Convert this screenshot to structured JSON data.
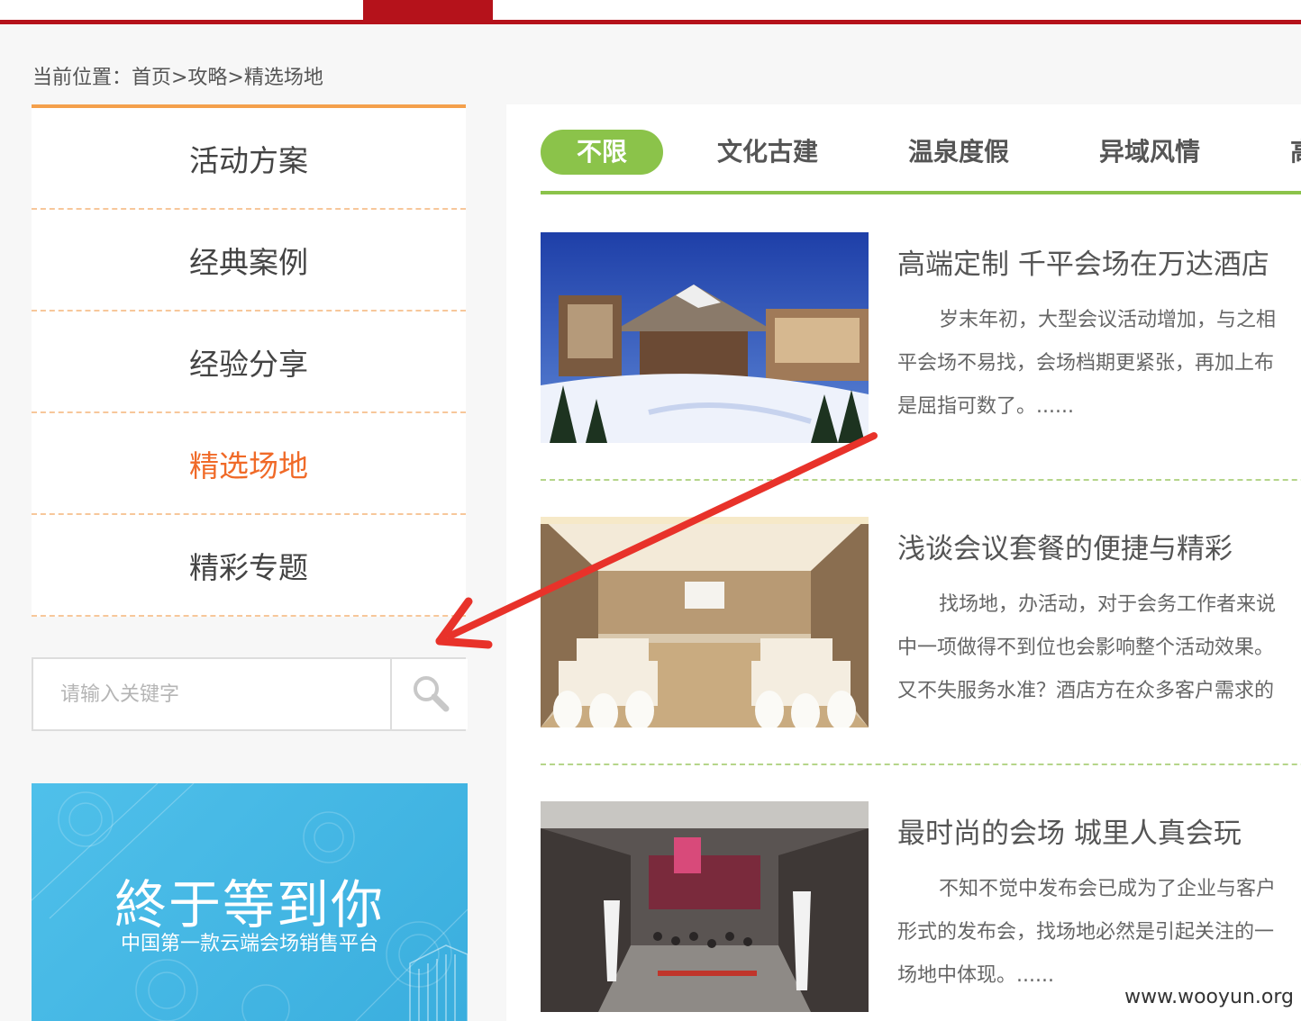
{
  "breadcrumb": {
    "text": "当前位置：首页>攻略>精选场地"
  },
  "sidebar": {
    "items": [
      {
        "label": "活动方案"
      },
      {
        "label": "经典案例"
      },
      {
        "label": "经验分享"
      },
      {
        "label": "精选场地",
        "active": true
      },
      {
        "label": "精彩专题"
      }
    ]
  },
  "search": {
    "placeholder": "请输入关键字",
    "button_icon": "search-icon"
  },
  "banner": {
    "title": "終于等到你",
    "subtitle": "中国第一款云端会场销售平台"
  },
  "filters": {
    "tabs": [
      {
        "label": "不限",
        "active": true
      },
      {
        "label": "文化古建"
      },
      {
        "label": "温泉度假"
      },
      {
        "label": "异域风情"
      },
      {
        "label": "高"
      }
    ]
  },
  "articles": [
    {
      "title": "高端定制 千平会场在万达酒店",
      "lines": [
        "岁末年初，大型会议活动增加，与之相",
        "平会场不易找，会场档期更紧张，再加上布",
        "是屈指可数了。......"
      ],
      "image": "ski-resort-hotel-photo"
    },
    {
      "title": "浅谈会议套餐的便捷与精彩",
      "lines": [
        "找场地，办活动，对于会务工作者来说",
        "中一项做得不到位也会影响整个活动效果。",
        "又不失服务水准？酒店方在众多客户需求的"
      ],
      "image": "conference-room-photo"
    },
    {
      "title": "最时尚的会场 城里人真会玩",
      "lines": [
        "不知不觉中发布会已成为了企业与客户",
        "形式的发布会，找场地必然是引起关注的一",
        "场地中体现。......"
      ],
      "image": "atrium-event-photo"
    }
  ],
  "watermark": "www.wooyun.org",
  "colors": {
    "brand_red": "#b5121b",
    "accent_orange": "#f06a28",
    "filter_green": "#8bc34a",
    "banner_blue": "#4fc0ea",
    "annotation_red": "#e8322a"
  }
}
